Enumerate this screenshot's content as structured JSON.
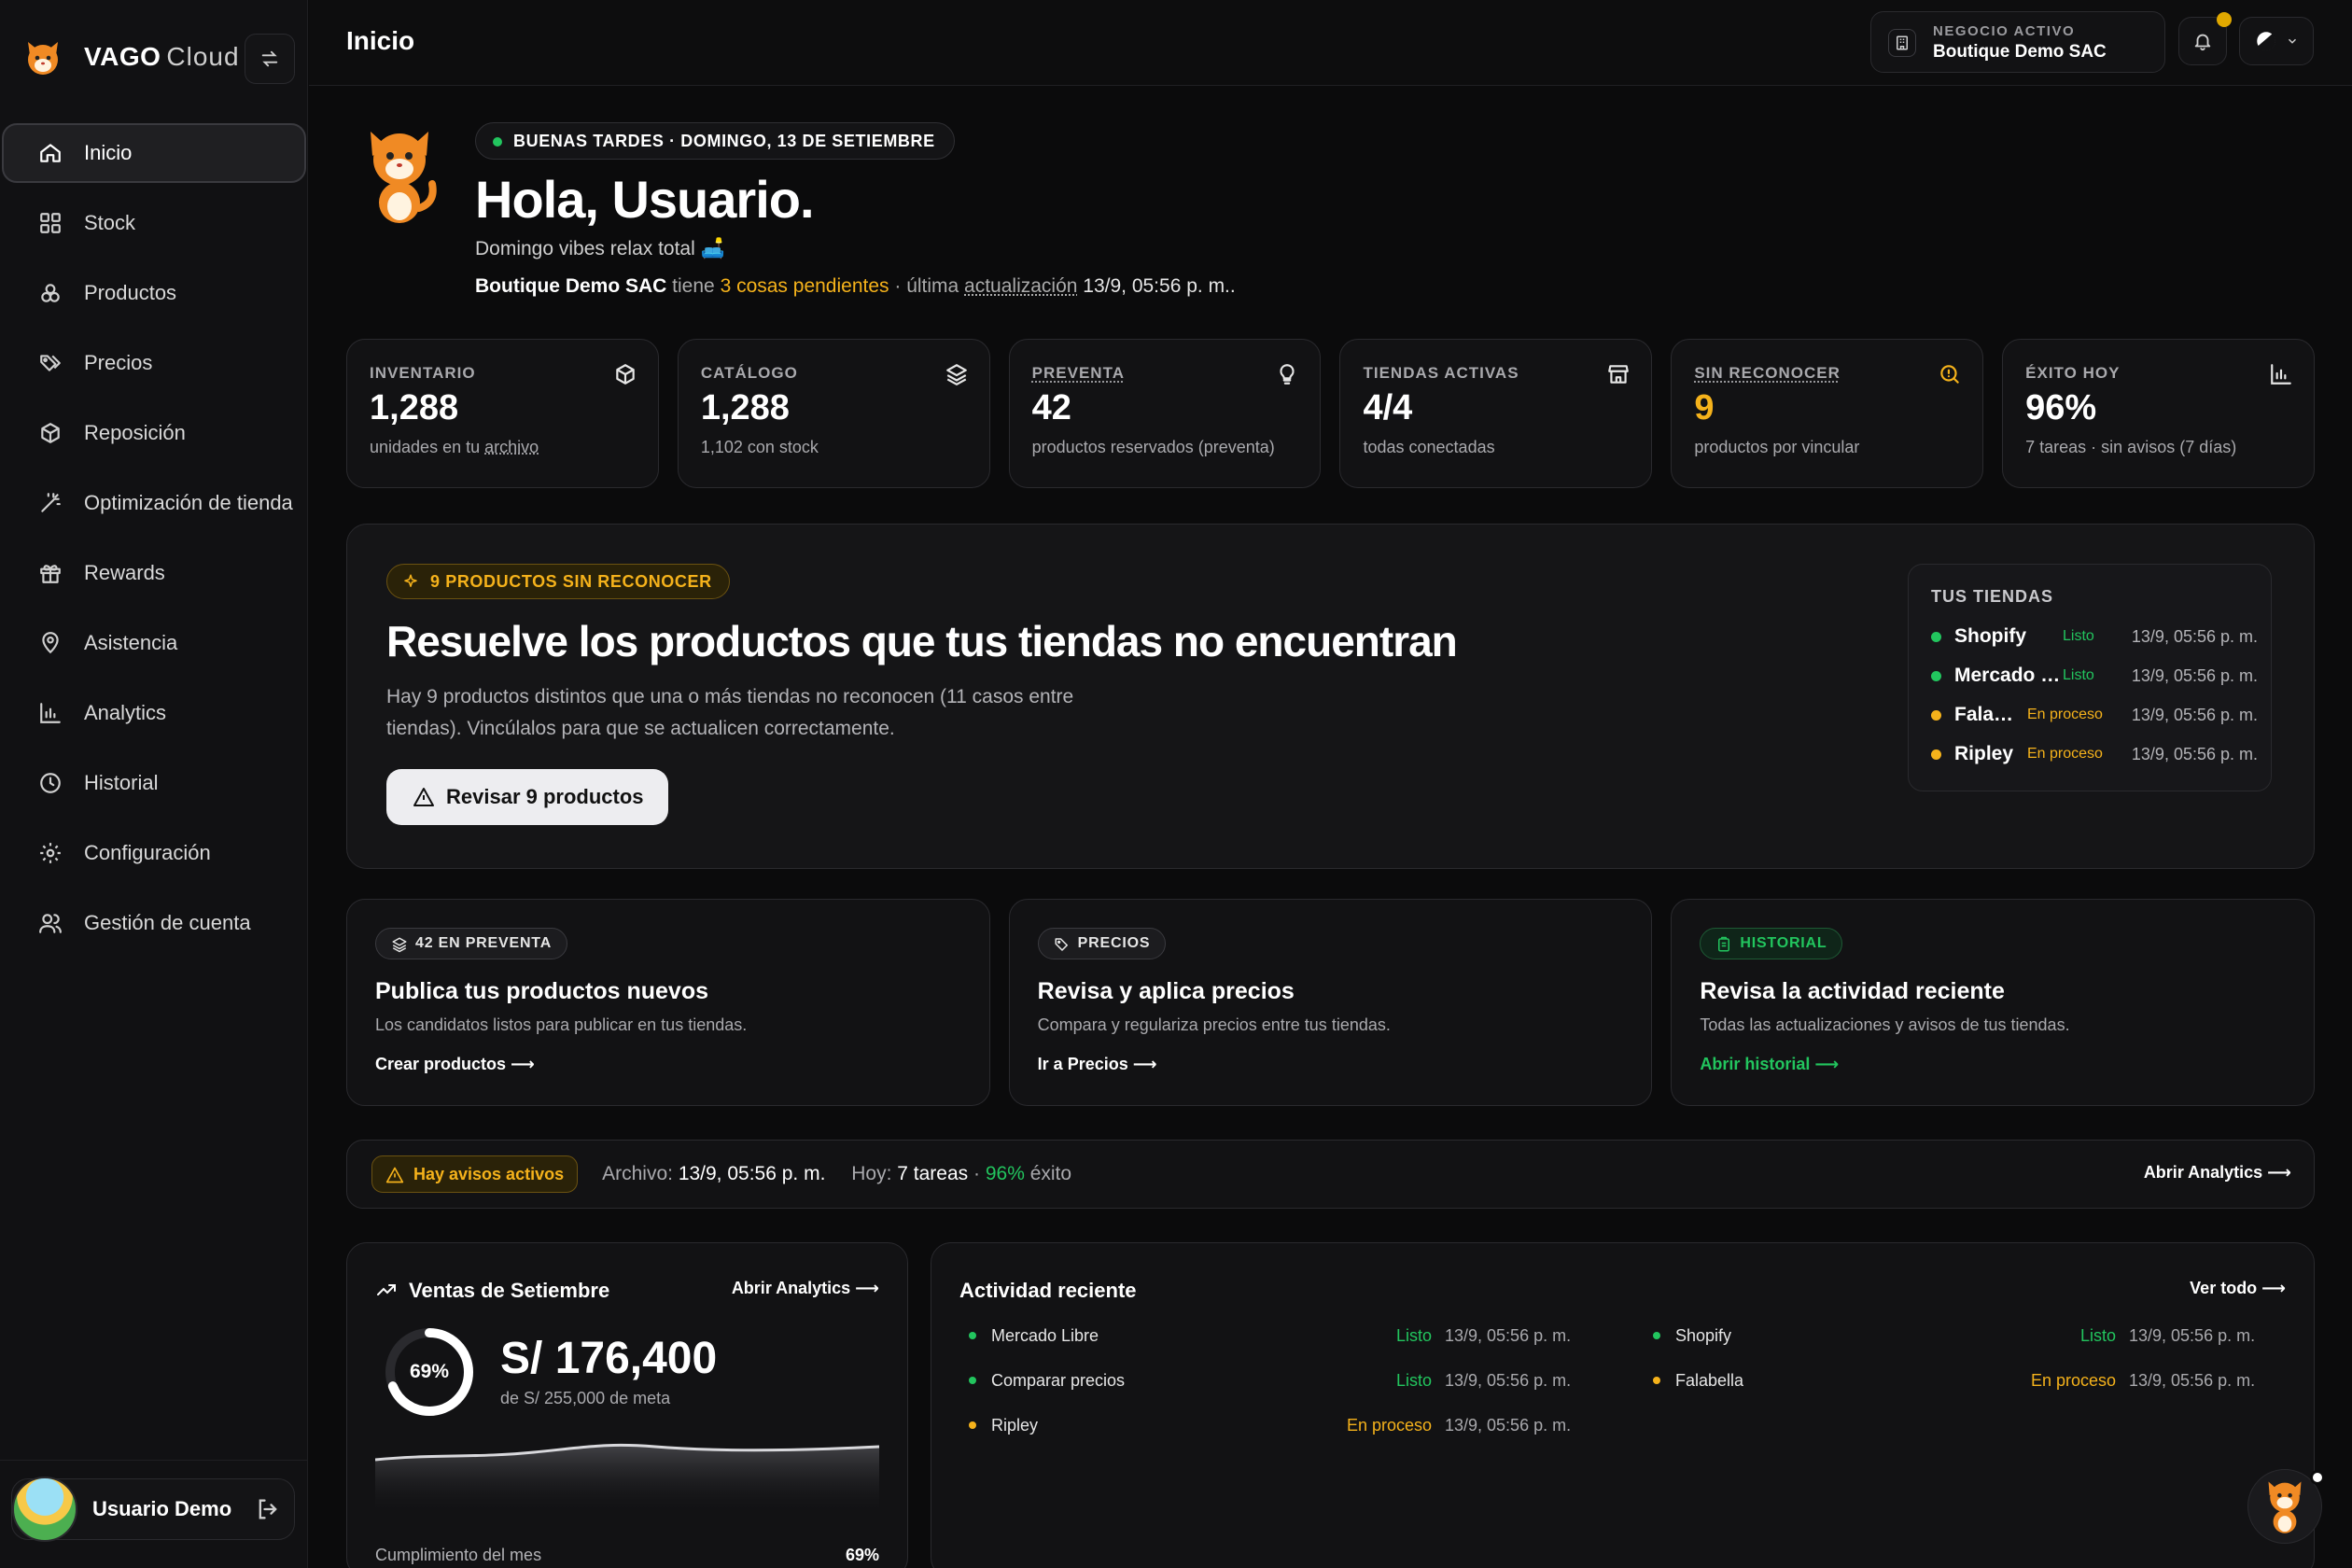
{
  "brand": {
    "name": "VAGO",
    "sub": "Cloud"
  },
  "sidebar": {
    "items": [
      {
        "label": "Inicio",
        "icon": "home-icon",
        "active": true
      },
      {
        "label": "Stock",
        "icon": "grid-icon"
      },
      {
        "label": "Productos",
        "icon": "boxes-icon"
      },
      {
        "label": "Precios",
        "icon": "tags-icon"
      },
      {
        "label": "Reposición",
        "icon": "package-refresh-icon"
      },
      {
        "label": "Optimización de tienda",
        "icon": "magic-wand-icon"
      },
      {
        "label": "Rewards",
        "icon": "gift-icon"
      },
      {
        "label": "Asistencia",
        "icon": "map-pin-icon"
      },
      {
        "label": "Analytics",
        "icon": "bar-chart-icon"
      },
      {
        "label": "Historial",
        "icon": "clock-icon"
      },
      {
        "label": "Configuración",
        "icon": "gear-icon"
      },
      {
        "label": "Gestión de cuenta",
        "icon": "users-icon"
      }
    ],
    "user": {
      "name": "Usuario Demo"
    }
  },
  "header": {
    "title": "Inicio",
    "business_label": "NEGOCIO ACTIVO",
    "business_name": "Boutique Demo SAC"
  },
  "hero": {
    "greeting_pill": "BUENAS TARDES · DOMINGO, 13 DE SETIEMBRE",
    "hello": "Hola, Usuario.",
    "vibes": "Domingo vibes relax total 🛋️",
    "business": "Boutique Demo SAC",
    "has": " tiene ",
    "pending": "3 cosas pendientes",
    "last_prefix": " · última ",
    "last_word": "actualización",
    "last_time": " 13/9, 05:56 p. m.."
  },
  "stats": [
    {
      "key": "INVENTARIO",
      "value": "1,288",
      "sub_a": "unidades en tu ",
      "sub_b": "archivo",
      "icon": "cube-icon"
    },
    {
      "key": "CATÁLOGO",
      "value": "1,288",
      "sub_a": "1,102 con stock",
      "sub_b": "",
      "icon": "layers-icon"
    },
    {
      "key": "PREVENTA",
      "value": "42",
      "sub_a": "productos reservados (preventa)",
      "sub_b": "",
      "icon": "lightbulb-icon"
    },
    {
      "key": "TIENDAS ACTIVAS",
      "value": "4/4",
      "sub_a": "todas conectadas",
      "sub_b": "",
      "icon": "store-icon"
    },
    {
      "key": "SIN RECONOCER",
      "value": "9",
      "sub_a": "productos por vincular",
      "sub_b": "",
      "icon": "search-alert-icon"
    },
    {
      "key": "ÉXITO HOY",
      "value": "96%",
      "sub_a": "7 tareas · sin avisos (7 días)",
      "sub_b": "",
      "icon": "bar-chart-icon"
    }
  ],
  "panel": {
    "pill": "9 PRODUCTOS SIN RECONOCER",
    "title": "Resuelve los productos que tus tiendas no encuentran",
    "desc": "Hay 9 productos distintos que una o más tiendas no reconocen (11 casos entre tiendas). Vincúlalos para que se actualicen correctamente.",
    "button": "Revisar 9 productos",
    "stores_title": "TUS TIENDAS",
    "stores": [
      {
        "name": "Shopify",
        "status": "Listo",
        "time": "13/9, 05:56 p. m.",
        "ok": true
      },
      {
        "name": "Mercado Libre",
        "status": "Listo",
        "time": "13/9, 05:56 p. m.",
        "ok": true
      },
      {
        "name": "Falabella",
        "status": "En proceso",
        "time": "13/9, 05:56 p. m.",
        "ok": false
      },
      {
        "name": "Ripley",
        "status": "En proceso",
        "time": "13/9, 05:56 p. m.",
        "ok": false
      }
    ]
  },
  "actions": [
    {
      "tag": "42 EN PREVENTA",
      "title": "Publica tus productos nuevos",
      "desc": "Los candidatos listos para publicar en tus tiendas.",
      "link": "Crear productos ⟶"
    },
    {
      "tag": "PRECIOS",
      "title": "Revisa y aplica precios",
      "desc": "Compara y regulariza precios entre tus tiendas.",
      "link": "Ir a Precios ⟶"
    },
    {
      "tag": "HISTORIAL",
      "title": "Revisa la actividad reciente",
      "desc": "Todas las actualizaciones y avisos de tus tiendas.",
      "link": "Abrir historial ⟶"
    }
  ],
  "alert": {
    "chip": "Hay avisos activos",
    "archivo_label": "Archivo: ",
    "archivo_time": "13/9, 05:56 p. m.",
    "hoy_label": "Hoy: ",
    "hoy_tasks": "7 tareas",
    "sep": " · ",
    "pct": "96%",
    "exito": " éxito",
    "link": "Abrir Analytics ⟶"
  },
  "sales": {
    "title": "Ventas de Setiembre",
    "link": "Abrir Analytics ⟶",
    "pct_label": "69%",
    "pct": 0.69,
    "amount": "S/ 176,400",
    "meta": "de S/ 255,000 de meta",
    "cumpl_label": "Cumplimiento del mes",
    "cumpl_value": "69%"
  },
  "activity": {
    "title": "Actividad reciente",
    "link": "Ver todo ⟶",
    "left": [
      {
        "name": "Mercado Libre",
        "status": "Listo",
        "time": "13/9, 05:56 p. m.",
        "ok": true
      },
      {
        "name": "Comparar precios",
        "status": "Listo",
        "time": "13/9, 05:56 p. m.",
        "ok": true
      },
      {
        "name": "Ripley",
        "status": "En proceso",
        "time": "13/9, 05:56 p. m.",
        "ok": false
      }
    ],
    "right": [
      {
        "name": "Shopify",
        "status": "Listo",
        "time": "13/9, 05:56 p. m.",
        "ok": true
      },
      {
        "name": "Falabella",
        "status": "En proceso",
        "time": "13/9, 05:56 p. m.",
        "ok": false
      }
    ]
  },
  "colors": {
    "accent_green": "#22c55e",
    "accent_amber": "#f5b21b",
    "bg": "#0b0b0c"
  }
}
